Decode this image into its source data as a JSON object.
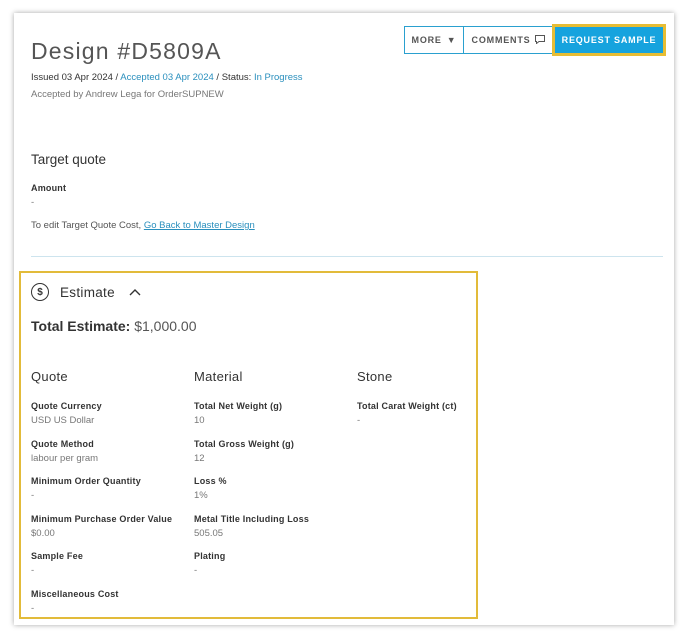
{
  "header": {
    "title": "Design #D5809A",
    "issued_label": "Issued",
    "issued_date": "03 Apr 2024",
    "separator": " / ",
    "accepted_text": "Accepted 03 Apr 2024",
    "status_label": "Status:",
    "status_value": "In Progress",
    "accepted_by": "Accepted by Andrew Lega for OrderSUPNEW"
  },
  "actions": {
    "more_label": "MORE",
    "more_icon": "caret-down-icon",
    "comments_label": "COMMENTS",
    "comments_icon": "comment-icon",
    "request_label": "REQUEST SAMPLE"
  },
  "target_quote": {
    "title": "Target quote",
    "amount_label": "Amount",
    "amount_value": "-",
    "edit_text": "To edit Target Quote Cost,",
    "edit_link": "Go Back to Master Design"
  },
  "estimate": {
    "title": "Estimate",
    "icon": "dollar-circle-icon",
    "toggle_icon": "chevron-up-icon",
    "total_label": "Total Estimate:",
    "total_value": "$1,000.00",
    "columns": [
      {
        "heading": "Quote",
        "fields": [
          {
            "label": "Quote Currency",
            "value": "USD US Dollar"
          },
          {
            "label": "Quote Method",
            "value": "labour per gram"
          },
          {
            "label": "Minimum Order Quantity",
            "value": "-"
          },
          {
            "label": "Minimum Purchase Order Value",
            "value": "$0.00"
          },
          {
            "label": "Sample Fee",
            "value": "-"
          },
          {
            "label": "Miscellaneous Cost",
            "value": "-"
          }
        ]
      },
      {
        "heading": "Material",
        "fields": [
          {
            "label": "Total Net Weight (g)",
            "value": "10"
          },
          {
            "label": "Total Gross Weight (g)",
            "value": "12"
          },
          {
            "label": "Loss %",
            "value": "1%"
          },
          {
            "label": "Metal Title Including Loss",
            "value": "505.05"
          },
          {
            "label": "Plating",
            "value": "-"
          }
        ]
      },
      {
        "heading": "Stone",
        "fields": [
          {
            "label": "Total Carat Weight (ct)",
            "value": "-"
          }
        ]
      }
    ]
  },
  "colors": {
    "accent": "#16a3de",
    "link": "#2a8fbd",
    "highlight": "#e2bb3a"
  }
}
